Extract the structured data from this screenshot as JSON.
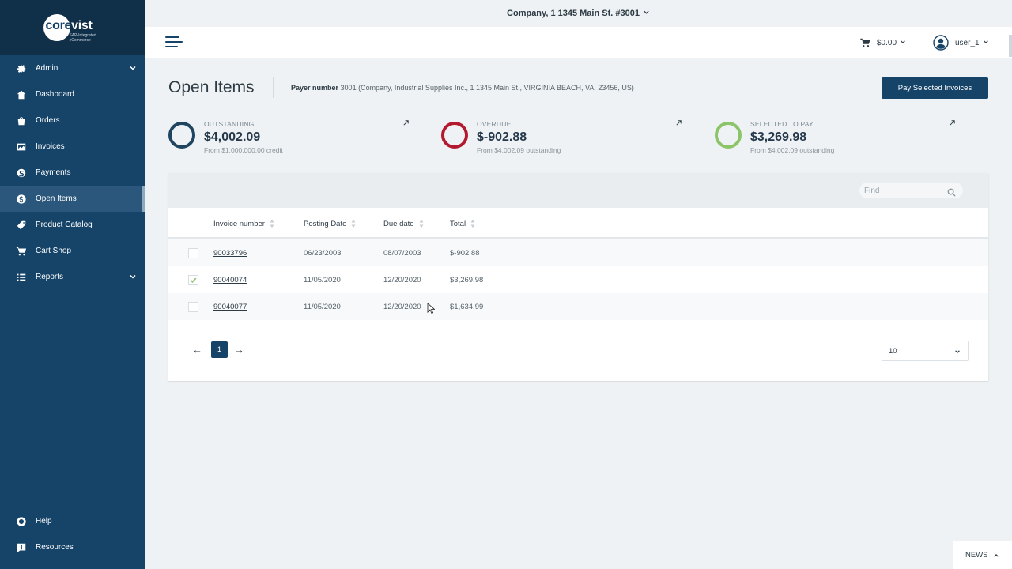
{
  "sidebar": {
    "logo": {
      "name": "corevist",
      "tagline": "SAP-Integrated eCommerce"
    },
    "items": [
      {
        "label": "Admin",
        "icon": "gear-icon",
        "has_submenu": true
      },
      {
        "label": "Dashboard",
        "icon": "dashboard-icon"
      },
      {
        "label": "Orders",
        "icon": "orders-icon"
      },
      {
        "label": "Invoices",
        "icon": "invoices-icon"
      },
      {
        "label": "Payments",
        "icon": "payments-icon"
      },
      {
        "label": "Open Items",
        "icon": "dollar-icon",
        "active": true
      },
      {
        "label": "Product Catalog",
        "icon": "tag-icon"
      },
      {
        "label": "Cart Shop",
        "icon": "cart-icon"
      },
      {
        "label": "Reports",
        "icon": "list-icon",
        "has_submenu": true
      }
    ],
    "bottom_items": [
      {
        "label": "Help",
        "icon": "lifebuoy-icon"
      },
      {
        "label": "Resources",
        "icon": "resources-icon"
      }
    ]
  },
  "company_bar": {
    "label": "Company, 1 1345 Main St. #3001"
  },
  "header": {
    "cart_total": "$0.00",
    "user_name": "user_1"
  },
  "page": {
    "title": "Open Items",
    "payer_label": "Payer number",
    "payer_value": "3001 (Company, Industrial Supplies Inc., 1 1345 Main St., VIRGINIA BEACH, VA, 23456, US)",
    "pay_button": "Pay Selected Invoices"
  },
  "stats": [
    {
      "label": "OUTSTANDING",
      "value": "$4,002.09",
      "sub": "From $1,000,000.00 credit",
      "color": "#1f4560"
    },
    {
      "label": "OVERDUE",
      "value": "$-902.88",
      "sub": "From $4,002.09 outstanding",
      "color": "#b3192f"
    },
    {
      "label": "SELECTED TO PAY",
      "value": "$3,269.98",
      "sub": "From $4,002.09 outstanding",
      "color": "#8cc46a"
    }
  ],
  "table": {
    "find_placeholder": "Find",
    "columns": [
      "Invoice number",
      "Posting Date",
      "Due date",
      "Total"
    ],
    "rows": [
      {
        "checked": false,
        "invoice": "90033796",
        "posting": "06/23/2003",
        "due": "08/07/2003",
        "total": "$-902.88"
      },
      {
        "checked": true,
        "invoice": "90040074",
        "posting": "11/05/2020",
        "due": "12/20/2020",
        "total": "$3,269.98"
      },
      {
        "checked": false,
        "invoice": "90040077",
        "posting": "11/05/2020",
        "due": "12/20/2020",
        "total": "$1,634.99"
      }
    ],
    "pagination": {
      "prev": "←",
      "current_page": "1",
      "next": "→",
      "page_size": "10"
    }
  },
  "news": {
    "label": "NEWS"
  }
}
